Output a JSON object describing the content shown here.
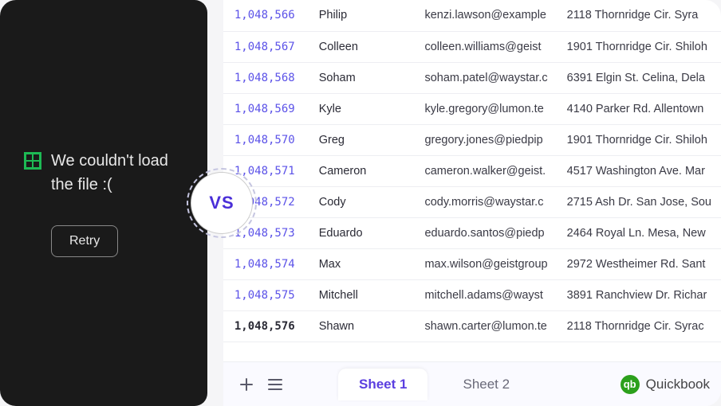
{
  "error": {
    "message": "We couldn't load the file :(",
    "retry_label": "Retry"
  },
  "vs_label": "VS",
  "rows": [
    {
      "id": "1,048,566",
      "name": "Philip",
      "email": "kenzi.lawson@example",
      "addr": "2118 Thornridge Cir. Syra"
    },
    {
      "id": "1,048,567",
      "name": "Colleen",
      "email": "colleen.williams@geist",
      "addr": "1901 Thornridge Cir. Shiloh"
    },
    {
      "id": "1,048,568",
      "name": "Soham",
      "email": "soham.patel@waystar.c",
      "addr": "6391 Elgin St. Celina, Dela"
    },
    {
      "id": "1,048,569",
      "name": "Kyle",
      "email": "kyle.gregory@lumon.te",
      "addr": "4140 Parker Rd. Allentown"
    },
    {
      "id": "1,048,570",
      "name": "Greg",
      "email": "gregory.jones@piedpip",
      "addr": "1901 Thornridge Cir. Shiloh"
    },
    {
      "id": "1,048,571",
      "name": "Cameron",
      "email": "cameron.walker@geist.",
      "addr": "4517 Washington Ave. Mar"
    },
    {
      "id": "1,048,572",
      "name": "Cody",
      "email": "cody.morris@waystar.c",
      "addr": "2715 Ash Dr. San Jose, Sou"
    },
    {
      "id": "1,048,573",
      "name": "Eduardo",
      "email": "eduardo.santos@piedp",
      "addr": "2464 Royal Ln. Mesa, New"
    },
    {
      "id": "1,048,574",
      "name": "Max",
      "email": "max.wilson@geistgroup",
      "addr": "2972 Westheimer Rd. Sant"
    },
    {
      "id": "1,048,575",
      "name": "Mitchell",
      "email": "mitchell.adams@wayst",
      "addr": "3891 Ranchview Dr. Richar"
    },
    {
      "id": "1,048,576",
      "name": "Shawn",
      "email": "shawn.carter@lumon.te",
      "addr": "2118 Thornridge Cir. Syrac"
    }
  ],
  "tabs": {
    "sheet1": "Sheet 1",
    "sheet2": "Sheet 2",
    "qb": "Quickbook"
  },
  "qb_glyph": "qb"
}
